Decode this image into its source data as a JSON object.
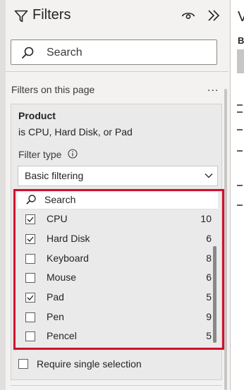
{
  "header": {
    "title": "Filters"
  },
  "search": {
    "placeholder": "Search"
  },
  "section": {
    "label": "Filters on this page",
    "more_label": "..."
  },
  "card": {
    "title": "Product",
    "subtitle": "is CPU, Hard Disk, or Pad",
    "filter_type_label": "Filter type",
    "filter_type_value": "Basic filtering",
    "list_search_placeholder": "Search",
    "items": [
      {
        "label": "CPU",
        "count": "10",
        "checked": true
      },
      {
        "label": "Hard Disk",
        "count": "6",
        "checked": true
      },
      {
        "label": "Keyboard",
        "count": "8",
        "checked": false
      },
      {
        "label": "Mouse",
        "count": "6",
        "checked": false
      },
      {
        "label": "Pad",
        "count": "5",
        "checked": true
      },
      {
        "label": "Pen",
        "count": "9",
        "checked": false
      },
      {
        "label": "Pencel",
        "count": "5",
        "checked": false
      }
    ],
    "single_selection_label": "Require single selection"
  },
  "right_pane": {
    "title_partial": "V",
    "label_partial": "B"
  },
  "colors": {
    "highlight": "#d3102d",
    "panel_bg": "#f3f2f1"
  },
  "icons": [
    "funnel-icon",
    "eye-icon",
    "chevron-double-right-icon",
    "search-icon",
    "info-icon",
    "chevron-down-icon",
    "checkmark-icon"
  ]
}
